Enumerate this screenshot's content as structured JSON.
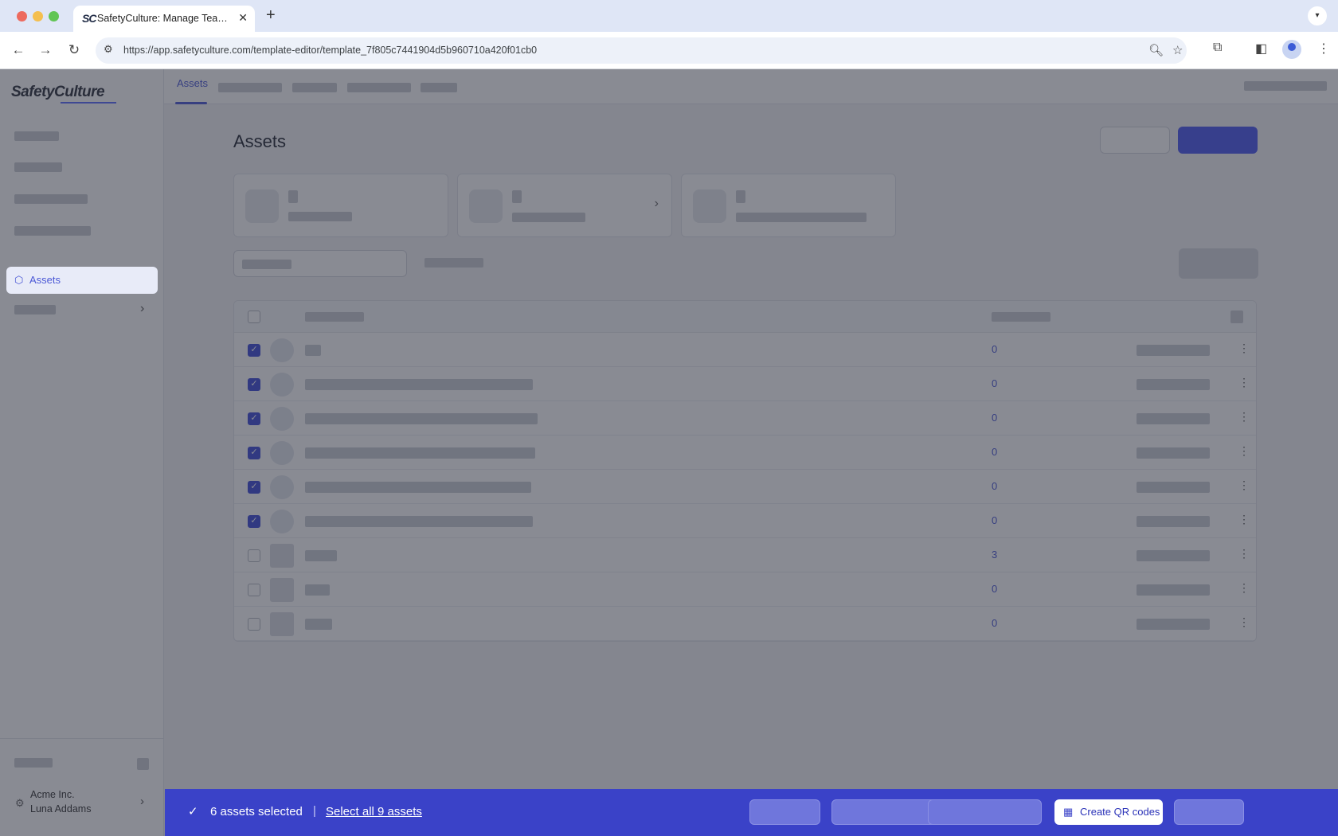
{
  "browser": {
    "tab_title": "SafetyCulture: Manage Teams and...",
    "tab_favicon": "SC",
    "url": "https://app.safetyculture.com/template-editor/template_7f805c7441904d5b960710a420f01cb0",
    "icons": [
      "back-icon",
      "forward-icon",
      "reload-icon",
      "site-info-icon",
      "zoom-icon",
      "star-icon",
      "extensions-icon",
      "side-panel-icon",
      "profile-icon",
      "menu-icon"
    ]
  },
  "sidebar": {
    "logo": "SafetyCulture",
    "active_item": "Assets",
    "org_name": "Acme Inc.",
    "user_name": "Luna Addams"
  },
  "topnav": {
    "active_tab": "Assets"
  },
  "page": {
    "title": "Assets"
  },
  "table": {
    "rows": [
      {
        "checked": true,
        "count": "0"
      },
      {
        "checked": true,
        "count": "0"
      },
      {
        "checked": true,
        "count": "0"
      },
      {
        "checked": true,
        "count": "0"
      },
      {
        "checked": true,
        "count": "0"
      },
      {
        "checked": true,
        "count": "0"
      },
      {
        "checked": false,
        "count": "3"
      },
      {
        "checked": false,
        "count": "0"
      },
      {
        "checked": false,
        "count": "0"
      }
    ]
  },
  "actionbar": {
    "selected_text": "6 assets selected",
    "separator": "|",
    "select_all": "Select all 9 assets",
    "create_qr": "Create QR codes"
  },
  "colors": {
    "accent": "#4b58d6",
    "actionbar": "#3a42c8"
  }
}
